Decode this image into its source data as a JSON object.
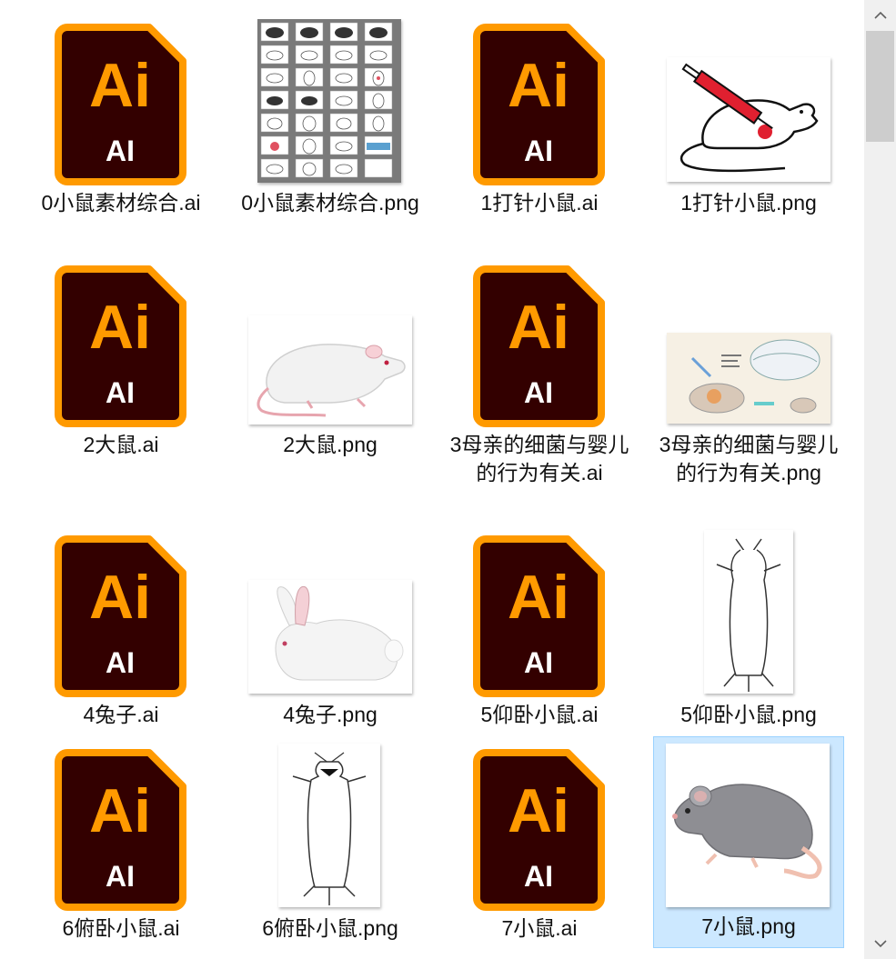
{
  "colors": {
    "ai_bg": "#330000",
    "ai_accent": "#ff9a00",
    "selection_bg": "#cce8ff",
    "selection_border": "#99d1ff",
    "scrollbar_track": "#f0f0f0",
    "scrollbar_thumb": "#cdcdcd"
  },
  "ai_icon": {
    "logo": "Ai",
    "ext": "AI"
  },
  "files": [
    {
      "name": "0小鼠素材综合.ai",
      "kind": "ai"
    },
    {
      "name": "0小鼠素材综合.png",
      "kind": "png",
      "thumb": "grid-sheet"
    },
    {
      "name": "1打针小鼠.ai",
      "kind": "ai"
    },
    {
      "name": "1打针小鼠.png",
      "kind": "png",
      "thumb": "mouse-injection"
    },
    {
      "name": "2大鼠.ai",
      "kind": "ai"
    },
    {
      "name": "2大鼠.png",
      "kind": "png",
      "thumb": "white-rat"
    },
    {
      "name": "3母亲的细菌与婴儿的行为有关.ai",
      "kind": "ai"
    },
    {
      "name": "3母亲的细菌与婴儿的行为有关.png",
      "kind": "png",
      "thumb": "diagram"
    },
    {
      "name": "4兔子.ai",
      "kind": "ai"
    },
    {
      "name": "4兔子.png",
      "kind": "png",
      "thumb": "rabbit"
    },
    {
      "name": "5仰卧小鼠.ai",
      "kind": "ai"
    },
    {
      "name": "5仰卧小鼠.png",
      "kind": "png",
      "thumb": "supine-mouse"
    },
    {
      "name": "6俯卧小鼠.ai",
      "kind": "ai"
    },
    {
      "name": "6俯卧小鼠.png",
      "kind": "png",
      "thumb": "prone-mouse"
    },
    {
      "name": "7小鼠.ai",
      "kind": "ai"
    },
    {
      "name": "7小鼠.png",
      "kind": "png",
      "thumb": "grey-mouse",
      "selected": true
    }
  ],
  "scrollbar": {
    "up_icon": "chevron-up-icon",
    "down_icon": "chevron-down-icon"
  }
}
